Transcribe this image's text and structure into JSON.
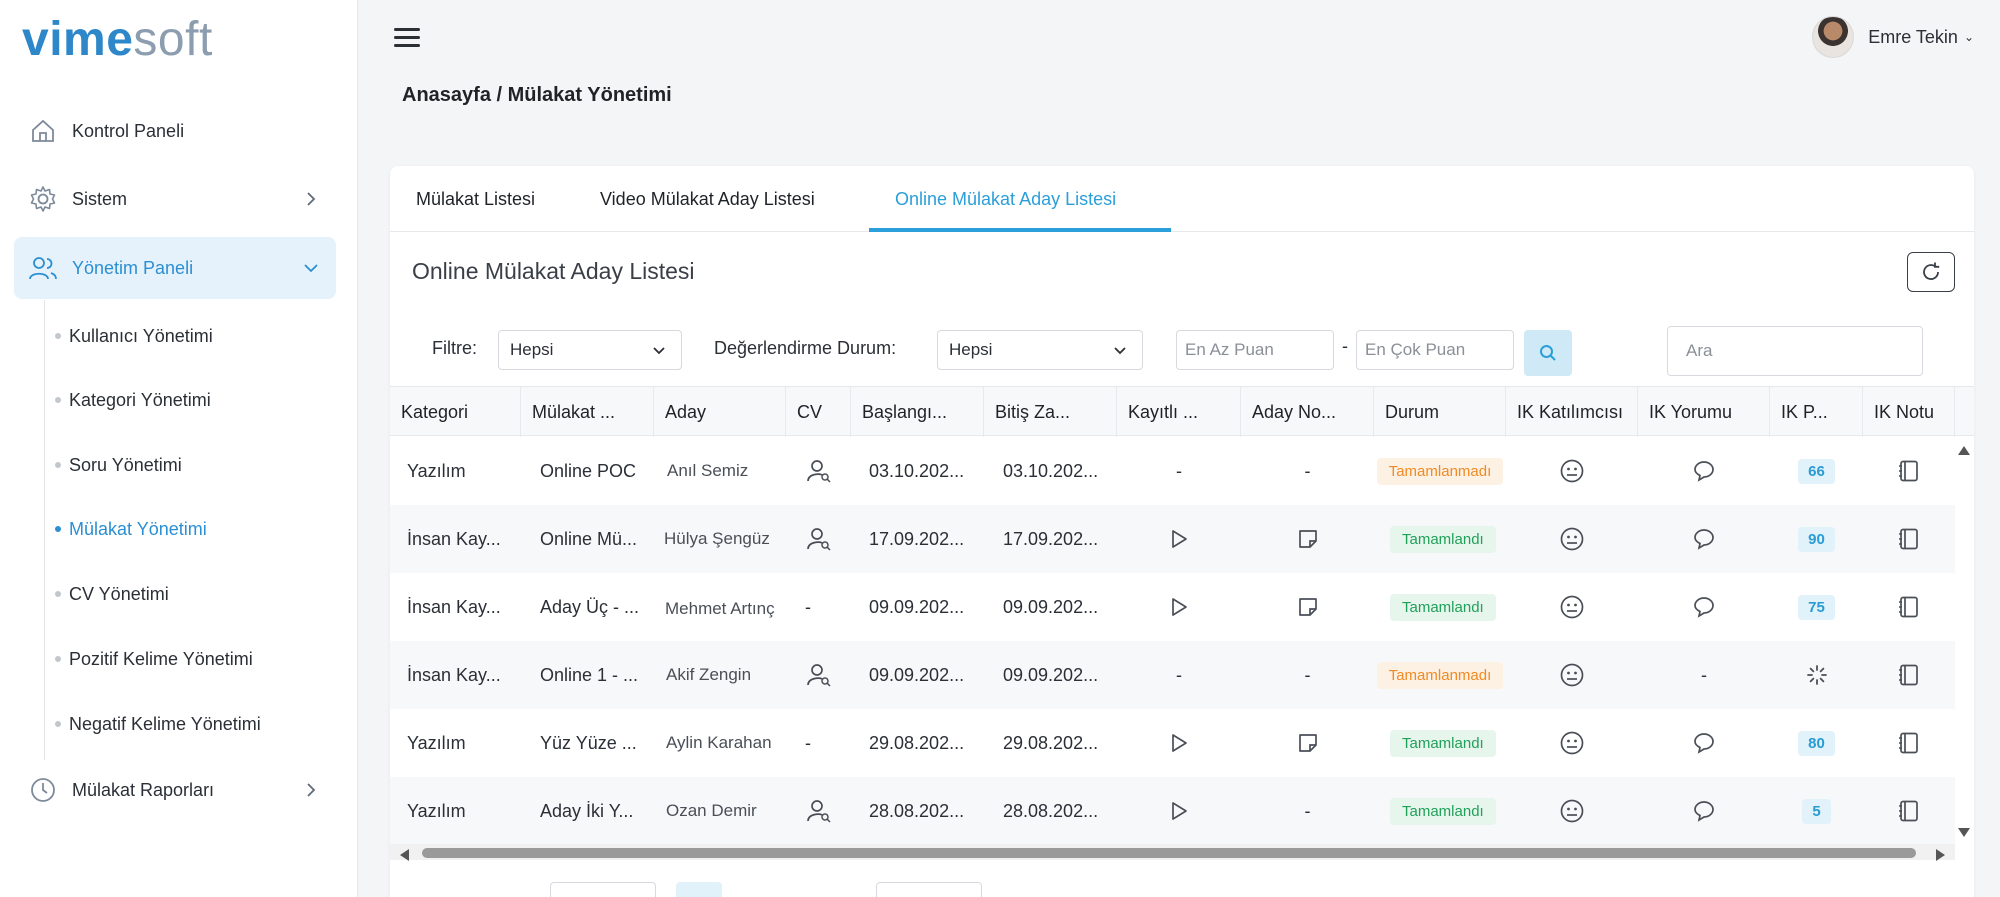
{
  "logo": {
    "part1": "vime",
    "part2": "soft"
  },
  "sidebar": {
    "items": [
      {
        "label": "Kontrol Paneli",
        "icon": "home-icon"
      },
      {
        "label": "Sistem",
        "icon": "gear-icon"
      },
      {
        "label": "Yönetim Paneli",
        "icon": "users-icon"
      },
      {
        "label": "Mülakat Raporları",
        "icon": "clock-icon"
      }
    ],
    "subitems": [
      "Kullanıcı Yönetimi",
      "Kategori Yönetimi",
      "Soru Yönetimi",
      "Mülakat Yönetimi",
      "CV Yönetimi",
      "Pozitif Kelime Yönetimi",
      "Negatif Kelime Yönetimi"
    ]
  },
  "header": {
    "user_name": "Emre Tekin",
    "breadcrumb": "Anasayfa / Mülakat Yönetimi"
  },
  "tabs": [
    "Mülakat Listesi",
    "Video Mülakat Aday Listesi",
    "Online Mülakat Aday Listesi"
  ],
  "card": {
    "title": "Online Mülakat Aday Listesi"
  },
  "filters": {
    "filter_label": "Filtre:",
    "filter_value": "Hepsi",
    "eval_label": "Değerlendirme Durum:",
    "eval_value": "Hepsi",
    "min_placeholder": "En Az Puan",
    "separator": "-",
    "max_placeholder": "En Çok Puan",
    "search_placeholder": "Ara"
  },
  "table": {
    "columns": [
      "Kategori",
      "Mülakat ...",
      "Aday",
      "CV",
      "Başlangı...",
      "Bitiş Za...",
      "Kayıtlı ...",
      "Aday No...",
      "Durum",
      "IK Katılımcısı",
      "IK Yorumu",
      "IK P...",
      "IK Notu"
    ],
    "rows": [
      {
        "kategori": "Yazılım",
        "mulakat": "Online POC",
        "aday": "Anıl Semiz",
        "cv": "icon",
        "baslangic": "03.10.202...",
        "bitis": "03.10.202...",
        "kayitli": "-",
        "aday_not": "-",
        "durum": "Tamamlanmadı",
        "durum_type": "warn",
        "ik_yorum": "icon",
        "ik_puan": "66"
      },
      {
        "kategori": "İnsan Kay...",
        "mulakat": "Online Mü...",
        "aday": "Hülya Şengüz",
        "cv": "icon",
        "baslangic": "17.09.202...",
        "bitis": "17.09.202...",
        "kayitli": "play",
        "aday_not": "note",
        "durum": "Tamamlandı",
        "durum_type": "ok",
        "ik_yorum": "icon",
        "ik_puan": "90"
      },
      {
        "kategori": "İnsan Kay...",
        "mulakat": "Aday Üç - ...",
        "aday": "Mehmet Artınç",
        "cv": "-",
        "baslangic": "09.09.202...",
        "bitis": "09.09.202...",
        "kayitli": "play",
        "aday_not": "note",
        "durum": "Tamamlandı",
        "durum_type": "ok",
        "ik_yorum": "icon",
        "ik_puan": "75"
      },
      {
        "kategori": "İnsan Kay...",
        "mulakat": "Online 1 - ...",
        "aday": "Akif Zengin",
        "cv": "icon",
        "baslangic": "09.09.202...",
        "bitis": "09.09.202...",
        "kayitli": "-",
        "aday_not": "-",
        "durum": "Tamamlanmadı",
        "durum_type": "warn",
        "ik_yorum": "-",
        "ik_puan": "loading"
      },
      {
        "kategori": "Yazılım",
        "mulakat": "Yüz Yüze ...",
        "aday": "Aylin Karahan",
        "cv": "-",
        "baslangic": "29.08.202...",
        "bitis": "29.08.202...",
        "kayitli": "play",
        "aday_not": "note",
        "durum": "Tamamlandı",
        "durum_type": "ok",
        "ik_yorum": "icon",
        "ik_puan": "80"
      },
      {
        "kategori": "Yazılım",
        "mulakat": "Aday İki Y...",
        "aday": "Ozan Demir",
        "cv": "icon",
        "baslangic": "28.08.202...",
        "bitis": "28.08.202...",
        "kayitli": "play",
        "aday_not": "-",
        "durum": "Tamamlandı",
        "durum_type": "ok",
        "ik_yorum": "icon",
        "ik_puan": "5"
      }
    ]
  },
  "colors": {
    "accent": "#2b9fd9",
    "success": "#21a05a",
    "warning": "#f08a24",
    "active_bg": "#e5f2fb"
  }
}
